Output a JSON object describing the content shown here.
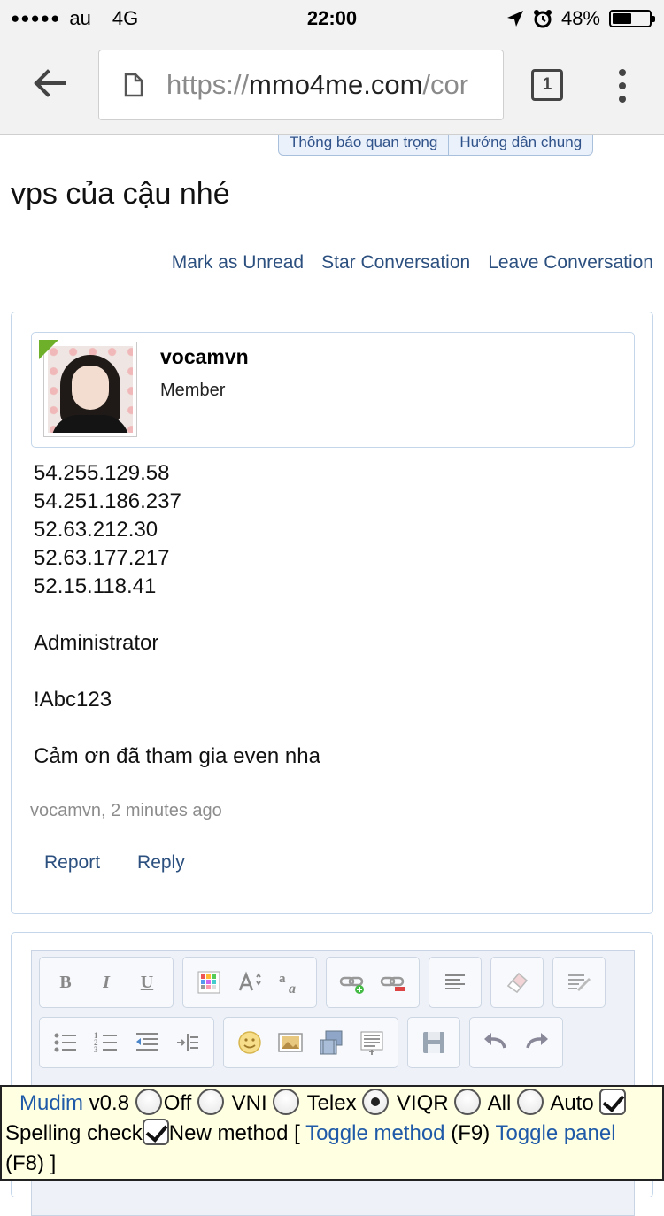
{
  "status_bar": {
    "signal": "●●●●●",
    "carrier": "au",
    "network": "4G",
    "time": "22:00",
    "battery": "48%",
    "battery_level": 0.48
  },
  "browser": {
    "url_scheme": "https://",
    "url_host": "mmo4me.com",
    "url_rest": "/cor",
    "tab_count": "1"
  },
  "tabs": [
    "Thông báo quan trọng",
    "Hướng dẫn chung"
  ],
  "page": {
    "title": "vps của cậu nhé",
    "actions": {
      "mark_unread": "Mark as Unread",
      "star": "Star Conversation",
      "leave": "Leave Conversation"
    }
  },
  "message": {
    "username": "vocamvn",
    "user_title": "Member",
    "lines": [
      "54.255.129.58",
      "54.251.186.237",
      "52.63.212.30",
      "52.63.177.217",
      "52.15.118.41",
      "Administrator",
      "!Abc123",
      "Cảm ơn đã tham gia even nha"
    ],
    "meta": "vocamvn, 2 minutes ago",
    "report": "Report",
    "reply": "Reply"
  },
  "editor": {
    "bold": "B",
    "italic": "I",
    "underline": "U"
  },
  "mudim": {
    "name": "Mudim",
    "version": " v0.8",
    "off": "Off",
    "vni": " VNI",
    "telex": " Telex",
    "viqr": " VIQR",
    "all": " All",
    "auto": " Auto",
    "spelling": "Spelling check",
    "new_method": "New method [ ",
    "toggle_method": "Toggle method",
    "f9": " (F9) ",
    "toggle_panel": "Toggle panel",
    "f8": " (F8) ]"
  }
}
